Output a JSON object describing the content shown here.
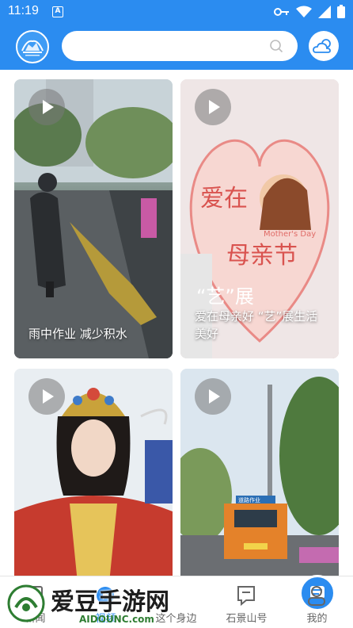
{
  "status_bar": {
    "time": "11:19",
    "a_badge": "A"
  },
  "header": {
    "search_placeholder": ""
  },
  "feed": [
    {
      "caption": "雨中作业 减少积水"
    },
    {
      "caption": "爱在母亲好 “艺”展生活美好",
      "poster_main": "爱在",
      "poster_sub": "母亲节",
      "poster_en": "Mother's Day",
      "poster_tag": "“艺”展",
      "poster_tag2": "生活美好"
    },
    {
      "caption": ""
    },
    {
      "caption": "",
      "truck_label": "道路作业"
    }
  ],
  "bottom_nav": [
    {
      "label": "新闻",
      "icon": "news-icon"
    },
    {
      "label": "视频",
      "icon": "video-icon",
      "active": true
    },
    {
      "label": "这个身边",
      "icon": "nearby-icon"
    },
    {
      "label": "石景山号",
      "icon": "shijingshan-icon"
    },
    {
      "label": "我的",
      "icon": "profile-icon"
    }
  ],
  "watermark": {
    "text": "爱豆手游网",
    "url": "AIDOUNC.com"
  },
  "colors": {
    "brand": "#2b8cf0"
  }
}
